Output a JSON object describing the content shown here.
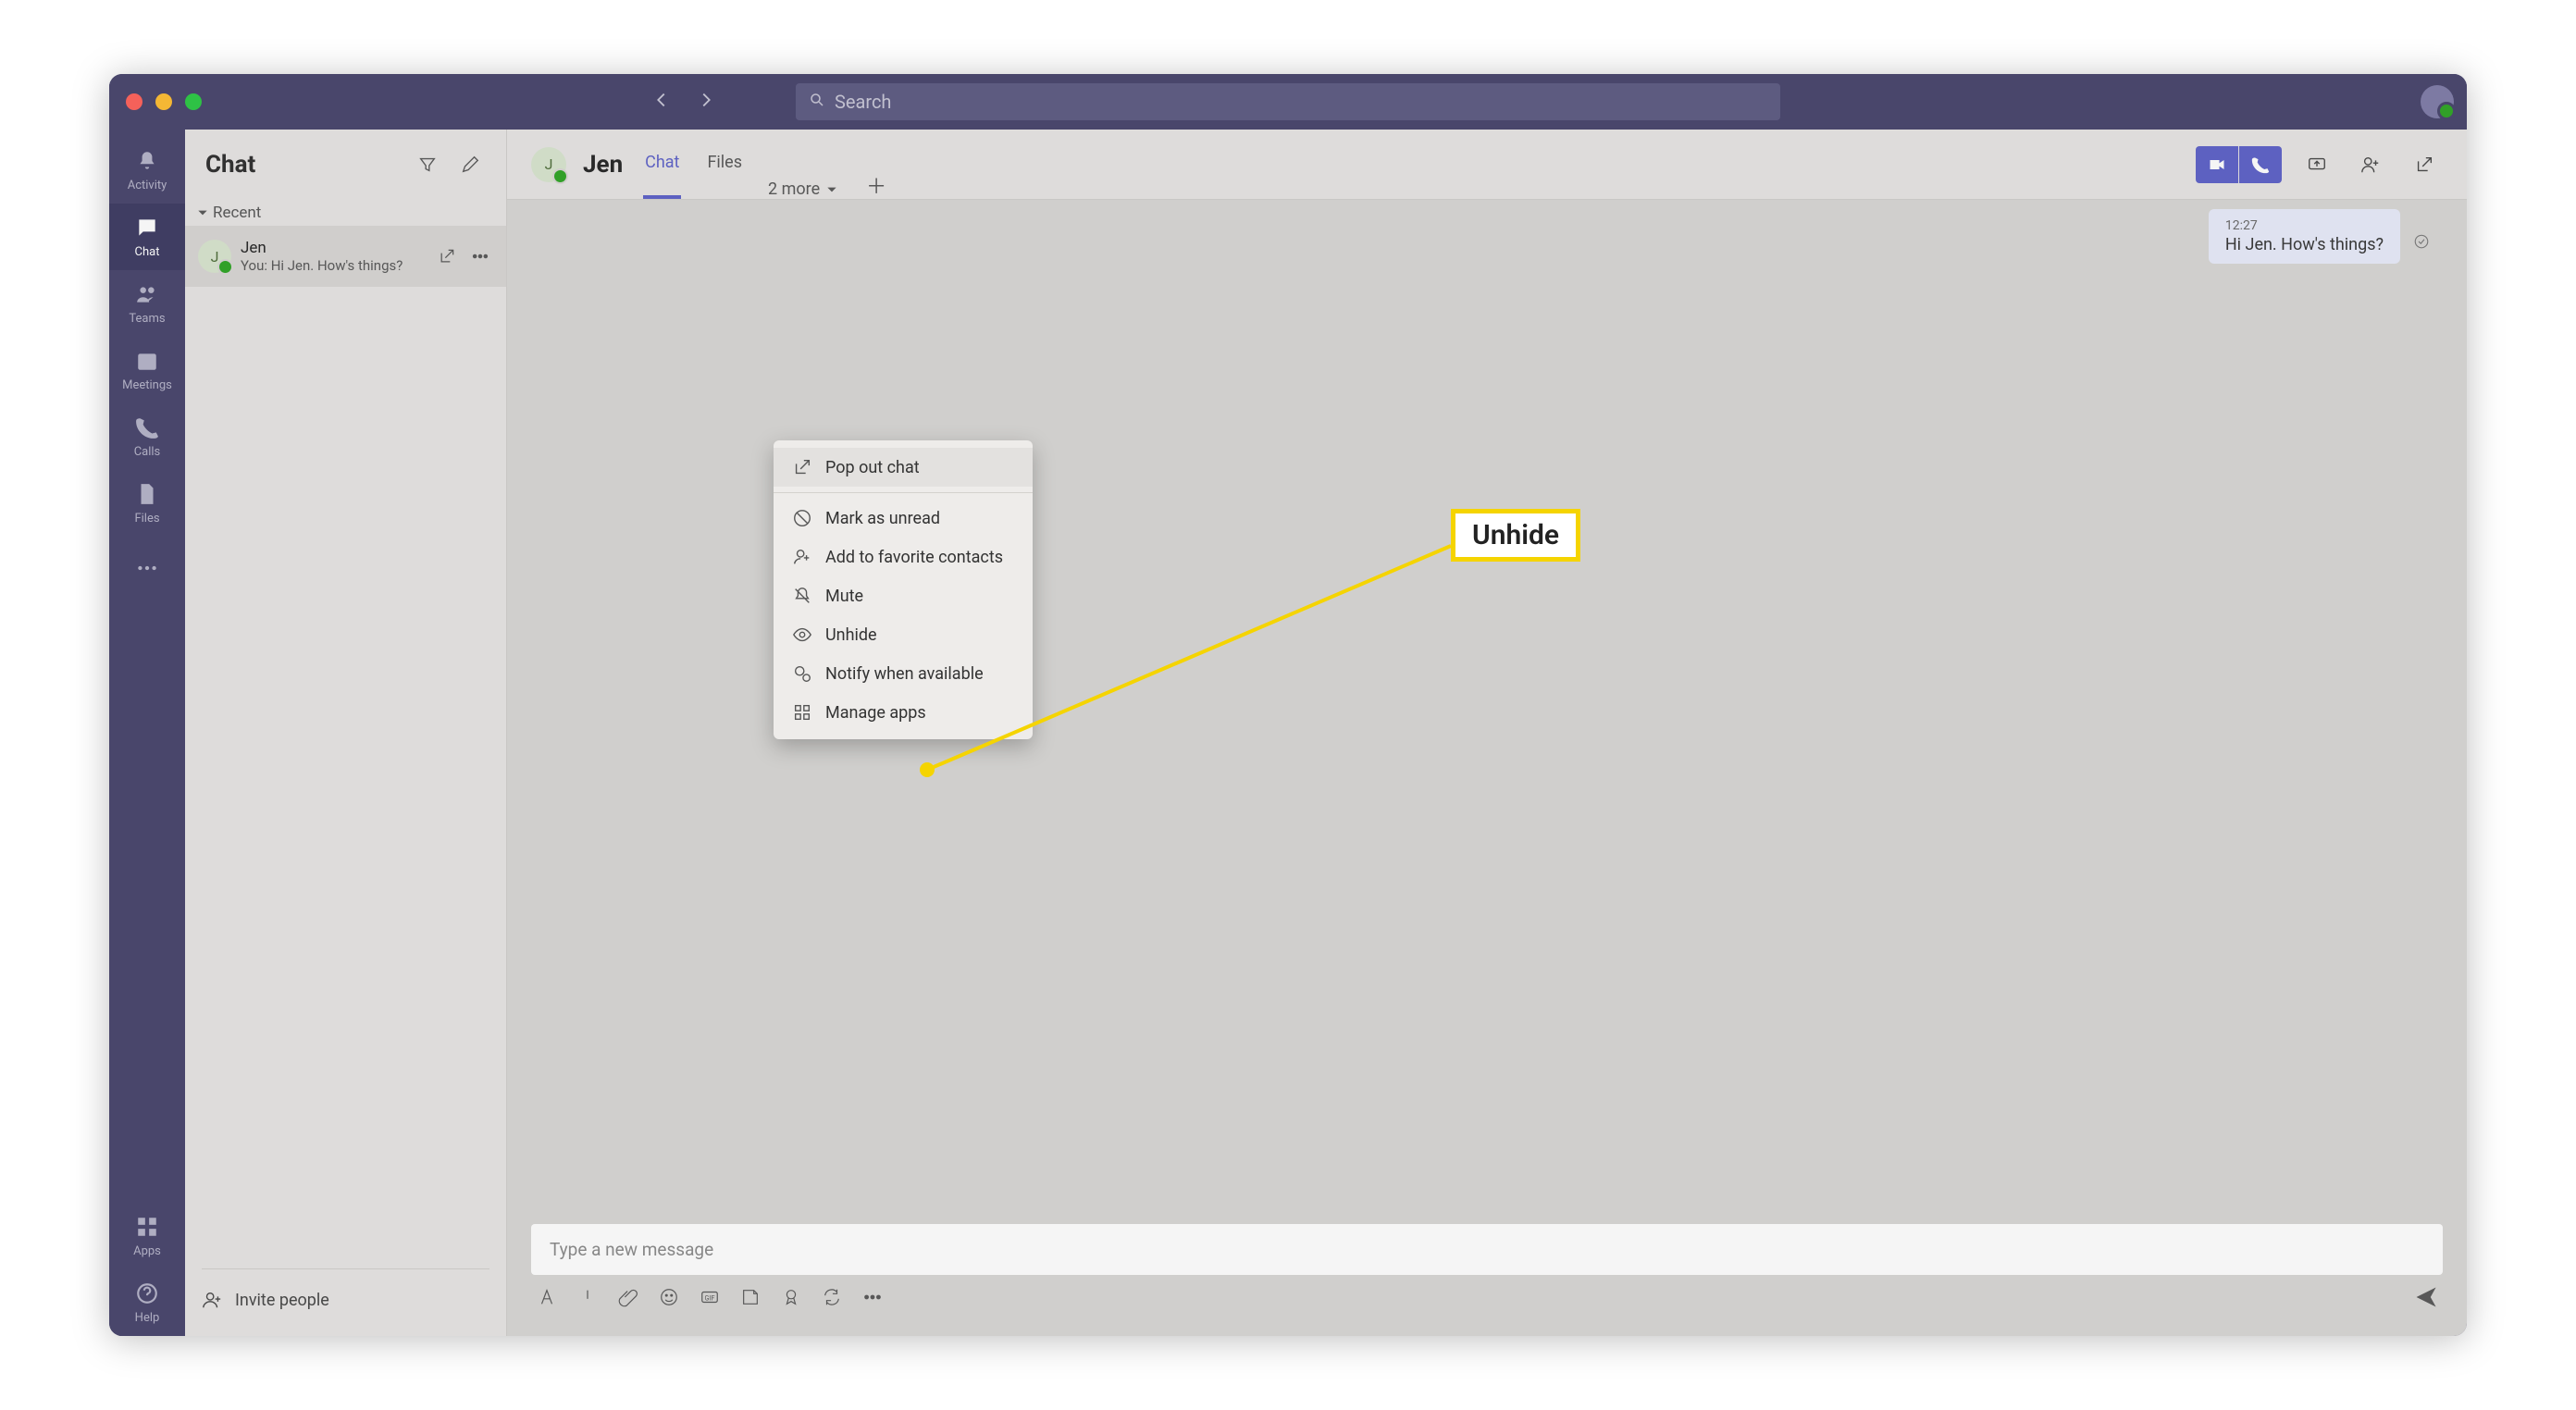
{
  "search": {
    "placeholder": "Search"
  },
  "rail": {
    "activity": "Activity",
    "chat": "Chat",
    "teams": "Teams",
    "meetings": "Meetings",
    "calls": "Calls",
    "files": "Files",
    "apps": "Apps",
    "help": "Help"
  },
  "list": {
    "heading": "Chat",
    "section": "Recent",
    "items": [
      {
        "initial": "J",
        "name": "Jen",
        "preview": "You: Hi Jen. How's things?"
      }
    ],
    "invite": "Invite people"
  },
  "contextMenu": {
    "popOut": "Pop out chat",
    "markUnread": "Mark as unread",
    "addFavorite": "Add to favorite contacts",
    "mute": "Mute",
    "unhide": "Unhide",
    "notify": "Notify when available",
    "manageApps": "Manage apps"
  },
  "conversation": {
    "avatarInitial": "J",
    "title": "Jen",
    "tabs": {
      "chat": "Chat",
      "files": "Files",
      "more": "2 more"
    },
    "message": {
      "timestamp": "12:27",
      "text": "Hi Jen. How's things?"
    },
    "composerPlaceholder": "Type a new message"
  },
  "annotation": {
    "label": "Unhide"
  }
}
